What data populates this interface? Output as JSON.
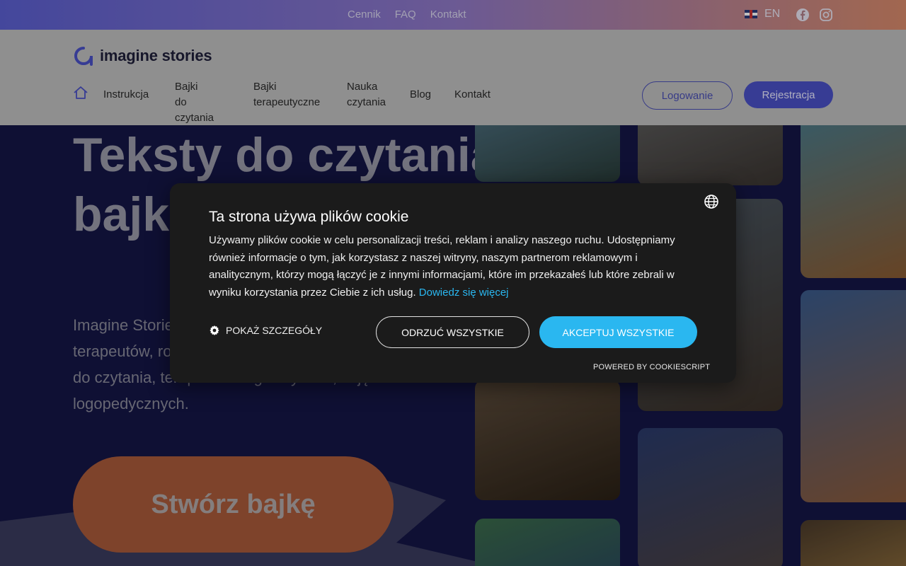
{
  "topbar": {
    "links": [
      "Cennik",
      "FAQ",
      "Kontakt"
    ],
    "language": "EN"
  },
  "header": {
    "logo_text": "imagine stories",
    "nav": {
      "instrukcja": "Instrukcja",
      "bajki_czytanie_1": "Bajki",
      "bajki_czytanie_2": "do czytania",
      "bajki_terapeutyczne_1": "Bajki",
      "bajki_terapeutyczne_2": "terapeutyczne",
      "nauka_1": "Nauka",
      "nauka_2": "czytania",
      "blog": "Blog",
      "kontakt": "Kontakt"
    },
    "login_label": "Logowanie",
    "register_label": "Rejestracja"
  },
  "hero": {
    "title": "Teksty do czytania, bajki dla dzieci",
    "subtitle": "Imagine Stories spersonalizowane bajki dla rodziców, terapeutów, rodziców. Stwórz unikalne opowiadania, bajki do czytania, terapii i treningu czytania, zajęć logopedycznych.",
    "cta": "Stwórz bajkę"
  },
  "cookie": {
    "title": "Ta strona używa plików cookie",
    "body": "Używamy plików cookie w celu personalizacji treści, reklam i analizy naszego ruchu. Udostępniamy również informacje o tym, jak korzystasz z naszej witryny, naszym partnerom reklamowym i analitycznym, którzy mogą łączyć je z innymi informacjami, które im przekazałeś lub które zebrali w wyniku korzystania przez Ciebie z ich usług.",
    "learn_more": "Dowiedz się więcej",
    "show_details": "POKAŻ SZCZEGÓŁY",
    "reject": "ODRZUĆ WSZYSTKIE",
    "accept": "AKCEPTUJ WSZYSTKIE",
    "powered_by": "POWERED BY COOKIESCRIPT"
  },
  "colors": {
    "accent": "#4a50c6",
    "cta": "#a85a3a",
    "cookie_accent": "#2ab7f0",
    "hero_bg": "#151646"
  },
  "icons": [
    "home-icon",
    "facebook-icon",
    "instagram-icon",
    "globe-icon",
    "gear-icon",
    "uk-flag-icon"
  ]
}
